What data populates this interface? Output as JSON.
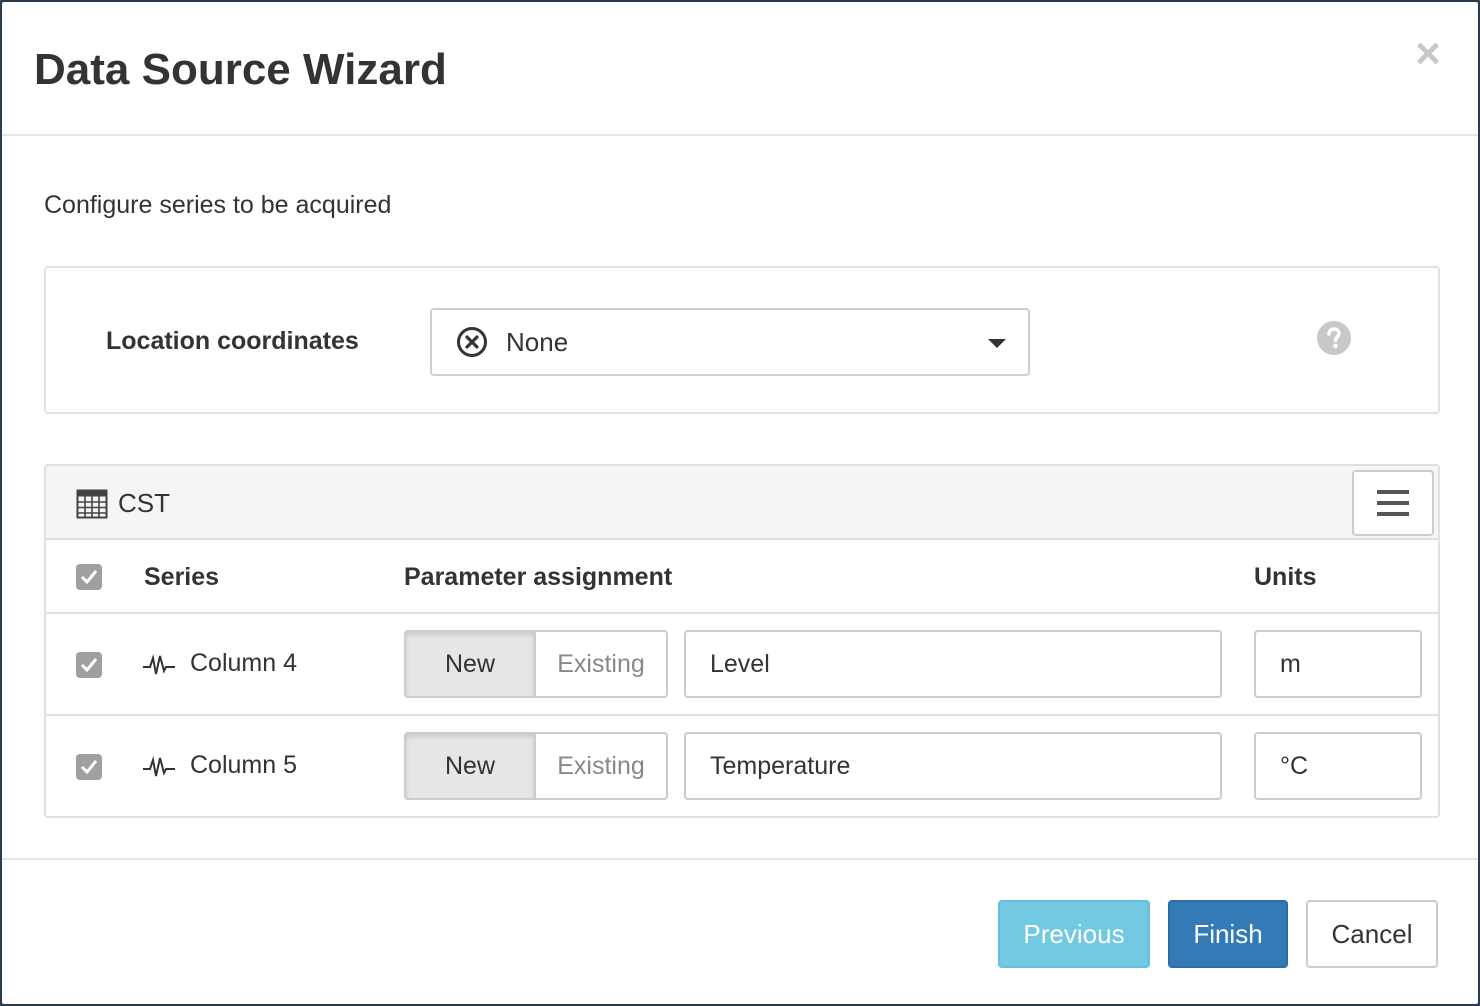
{
  "dialog": {
    "title": "Data Source Wizard",
    "close_label": "×"
  },
  "intro": "Configure series to be acquired",
  "location": {
    "label": "Location coordinates",
    "selected": "None",
    "selected_icon": "circle-x-icon",
    "help_icon": "question-circle-icon"
  },
  "table": {
    "title": "CST",
    "title_icon": "table-icon",
    "menu_icon": "hamburger-menu-icon",
    "headers": {
      "series": "Series",
      "parameter": "Parameter assignment",
      "units": "Units"
    },
    "header_checked": true,
    "rows": [
      {
        "checked": true,
        "icon": "waveform-icon",
        "name": "Column 4",
        "mode_new": "New",
        "mode_existing": "Existing",
        "selected_mode": "New",
        "parameter": "Level",
        "unit": "m"
      },
      {
        "checked": true,
        "icon": "waveform-icon",
        "name": "Column 5",
        "mode_new": "New",
        "mode_existing": "Existing",
        "selected_mode": "New",
        "parameter": "Temperature",
        "unit": "°C"
      }
    ]
  },
  "footer": {
    "previous": "Previous",
    "finish": "Finish",
    "cancel": "Cancel"
  },
  "colors": {
    "previous_bg": "#5bc0de",
    "finish_bg": "#337ab7",
    "checkbox_bg": "#a0a0a0"
  }
}
